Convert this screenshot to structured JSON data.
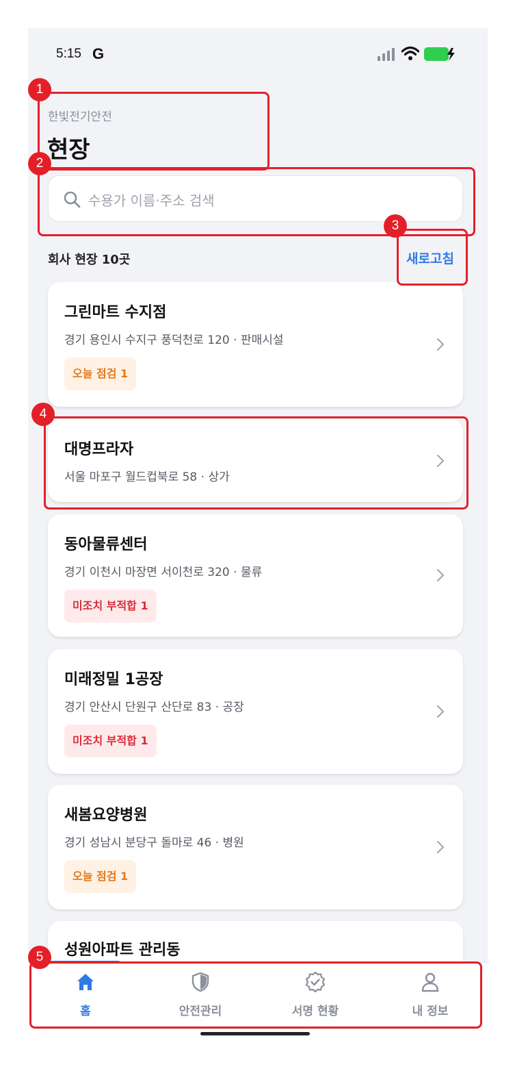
{
  "status_bar": {
    "time": "5:15",
    "g_label": "G"
  },
  "header": {
    "org_name": "한빛전기안전",
    "title": "현장"
  },
  "search": {
    "placeholder": "수용가 이름·주소 검색"
  },
  "list_header": {
    "count_label": "회사 현장 10곳",
    "refresh_label": "새로고침"
  },
  "sites": [
    {
      "name": "그린마트 수지점",
      "address": "경기 용인시 수지구 풍덕천로 120 · 판매시설",
      "badge": "오늘 점검 1",
      "badge_type": "orange"
    },
    {
      "name": "대명프라자",
      "address": "서울 마포구 월드컵북로 58 · 상가",
      "badge": "",
      "badge_type": ""
    },
    {
      "name": "동아물류센터",
      "address": "경기 이천시 마장면 서이천로 320 · 물류",
      "badge": "미조치 부적합 1",
      "badge_type": "red"
    },
    {
      "name": "미래정밀 1공장",
      "address": "경기 안산시 단원구 산단로 83 · 공장",
      "badge": "미조치 부적합 1",
      "badge_type": "red"
    },
    {
      "name": "새봄요양병원",
      "address": "경기 성남시 분당구 돌마로 46 · 병원",
      "badge": "오늘 점검 1",
      "badge_type": "orange"
    },
    {
      "name": "성원아파트 관리동",
      "address": "",
      "badge": "",
      "badge_type": ""
    }
  ],
  "tabs": [
    {
      "label": "홈",
      "icon": "home-icon",
      "active": true
    },
    {
      "label": "안전관리",
      "icon": "shield-icon",
      "active": false
    },
    {
      "label": "서명 현황",
      "icon": "check-badge-icon",
      "active": false
    },
    {
      "label": "내 정보",
      "icon": "user-icon",
      "active": false
    }
  ],
  "annotations": [
    "1",
    "2",
    "3",
    "4",
    "5"
  ],
  "colors": {
    "accent": "#2f7ae5",
    "annotation": "#e3202a",
    "badge_orange": "#e37a1c",
    "badge_red": "#d92c38"
  }
}
